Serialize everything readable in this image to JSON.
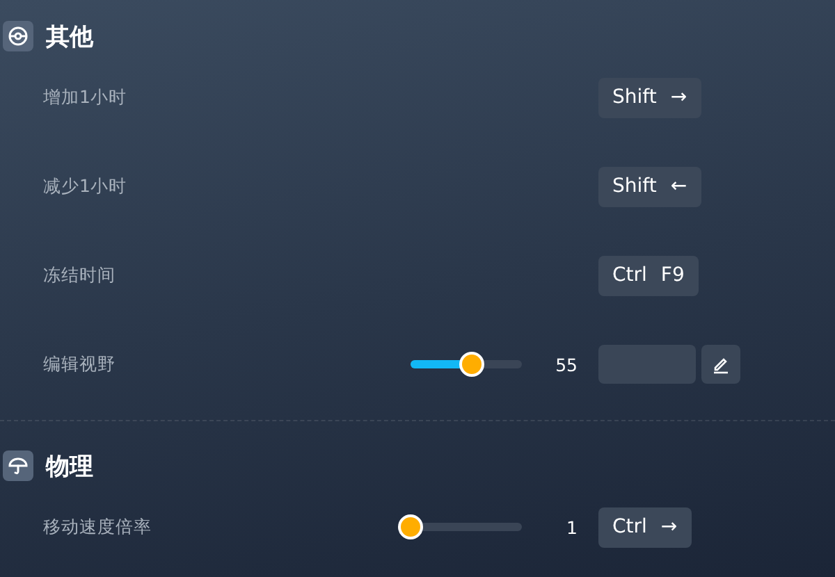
{
  "sections": [
    {
      "title": "其他",
      "rows": [
        {
          "label": "增加1小时",
          "control": {
            "kind": "hotkey",
            "keys": [
              "Shift",
              "→"
            ]
          }
        },
        {
          "label": "减少1小时",
          "control": {
            "kind": "hotkey",
            "keys": [
              "Shift",
              "←"
            ]
          }
        },
        {
          "label": "冻结时间",
          "control": {
            "kind": "hotkey",
            "keys": [
              "Ctrl",
              "F9"
            ]
          }
        },
        {
          "label": "编辑视野",
          "slider": {
            "level": 0.55,
            "reading": "55"
          },
          "control": {
            "kind": "field"
          }
        }
      ]
    },
    {
      "title": "物理",
      "rows": [
        {
          "label": "移动速度倍率",
          "slider": {
            "level": 0,
            "reading": "1"
          },
          "control": {
            "kind": "hotkey",
            "keys": [
              "Ctrl",
              "→"
            ]
          }
        }
      ]
    }
  ]
}
